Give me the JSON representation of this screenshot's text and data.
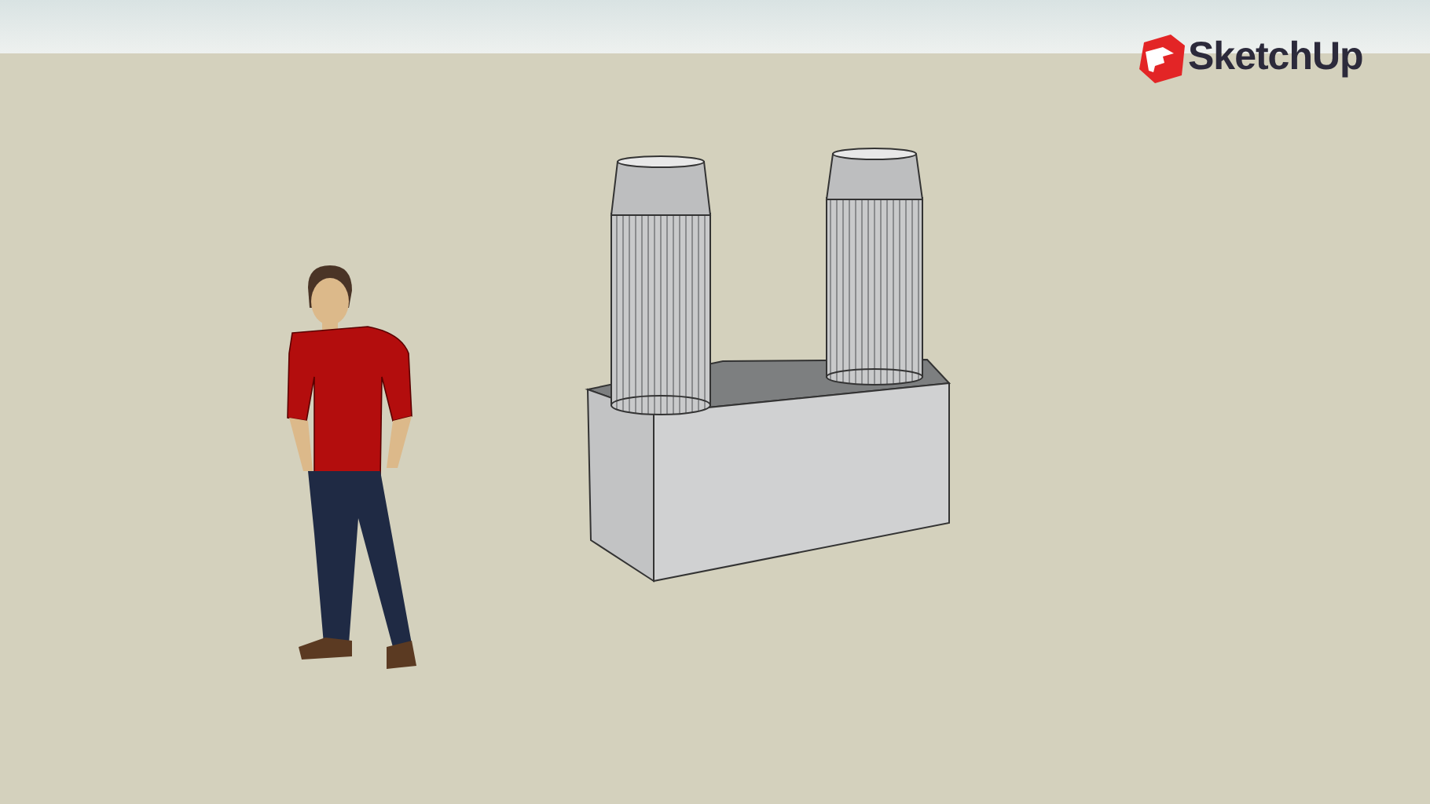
{
  "viewport": {
    "logo": {
      "text": "SketchUp"
    }
  }
}
